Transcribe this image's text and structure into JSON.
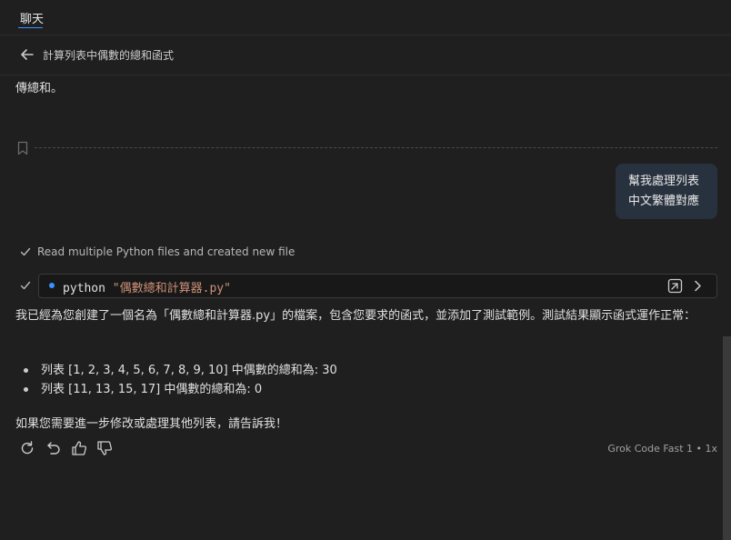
{
  "tab": {
    "label": "聊天"
  },
  "header": {
    "title": "計算列表中偶數的總和函式"
  },
  "conversation": {
    "clipped_text": "傳總和。",
    "user_message": {
      "line1": "幫我處理列表",
      "line2": "中文繁體對應"
    },
    "tool_status": "Read multiple Python files and created new file",
    "command": {
      "keyword": "python",
      "argument": "\"偶數總和計算器.py\""
    },
    "response": {
      "paragraph": "我已經為您創建了一個名為「偶數總和計算器.py」的檔案，包含您要求的函式，並添加了測試範例。測試結果顯示函式運作正常：",
      "bullets": [
        "列表 [1, 2, 3, 4, 5, 6, 7, 8, 9, 10] 中偶數的總和為: 30",
        "列表 [11, 13, 15, 17] 中偶數的總和為: 0"
      ],
      "closing": "如果您需要進一步修改或處理其他列表，請告訴我！"
    },
    "model_label": "Grok Code Fast 1 • 1x"
  },
  "icons": {
    "back": "arrow-left-icon",
    "bookmark": "bookmark-icon",
    "check": "check-icon",
    "open": "open-in-editor-icon",
    "expand": "chevron-right-icon",
    "retry": "retry-icon",
    "undo": "undo-icon",
    "thumbs_up": "thumbs-up-icon",
    "thumbs_down": "thumbs-down-icon"
  },
  "colors": {
    "background": "#1f1f1f",
    "accent": "#3794ff",
    "user_bubble": "#28323e",
    "string": "#ce9178"
  }
}
